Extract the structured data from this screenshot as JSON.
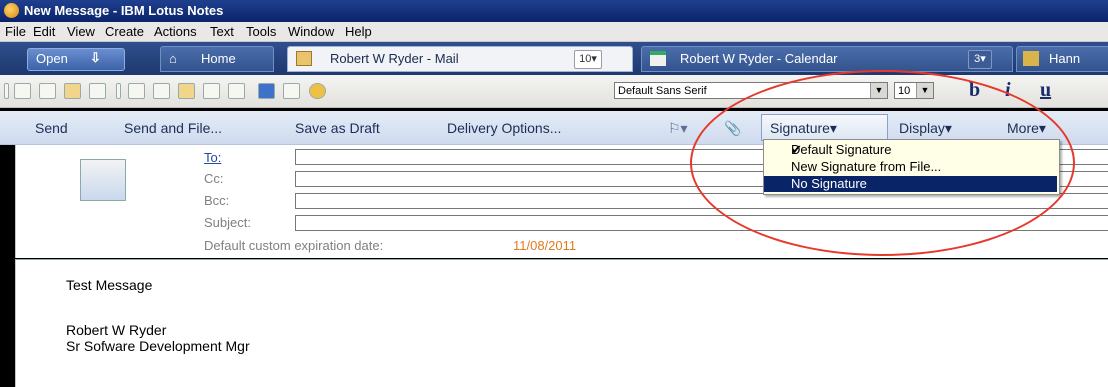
{
  "window": {
    "title": "New Message - IBM Lotus Notes"
  },
  "menu": [
    "File",
    "Edit",
    "View",
    "Create",
    "Actions",
    "Text",
    "Tools",
    "Window",
    "Help"
  ],
  "tabs": {
    "open": "Open",
    "home": "Home",
    "mail": {
      "label": "Robert W Ryder - Mail",
      "count": "10▾"
    },
    "calendar": {
      "label": "Robert W Ryder - Calendar",
      "count": "3▾"
    },
    "partial": "Hann"
  },
  "toolbar": {
    "font": "Default Sans Serif",
    "size": "10",
    "bold": "b",
    "italic": "i",
    "underline": "u"
  },
  "actions": {
    "send": "Send",
    "send_file": "Send and File...",
    "save_draft": "Save as Draft",
    "delivery": "Delivery Options...",
    "signature": "Signature▾",
    "display": "Display▾",
    "more": "More▾"
  },
  "signature_menu": {
    "items": [
      "Default Signature",
      "New Signature from File...",
      "No Signature"
    ],
    "checked": "✔"
  },
  "form": {
    "to": "To:",
    "cc": "Cc:",
    "bcc": "Bcc:",
    "subject": "Subject:",
    "expiration_label": "Default custom expiration date:",
    "expiration_date": "11/08/2011"
  },
  "body": {
    "line1": "Test Message",
    "sig_name": "Robert W Ryder",
    "sig_title": "Sr Sofware Development Mgr"
  },
  "colors": {
    "annotation": "#e6392c",
    "highlight": "#0a2468",
    "date": "#e07a1f"
  }
}
